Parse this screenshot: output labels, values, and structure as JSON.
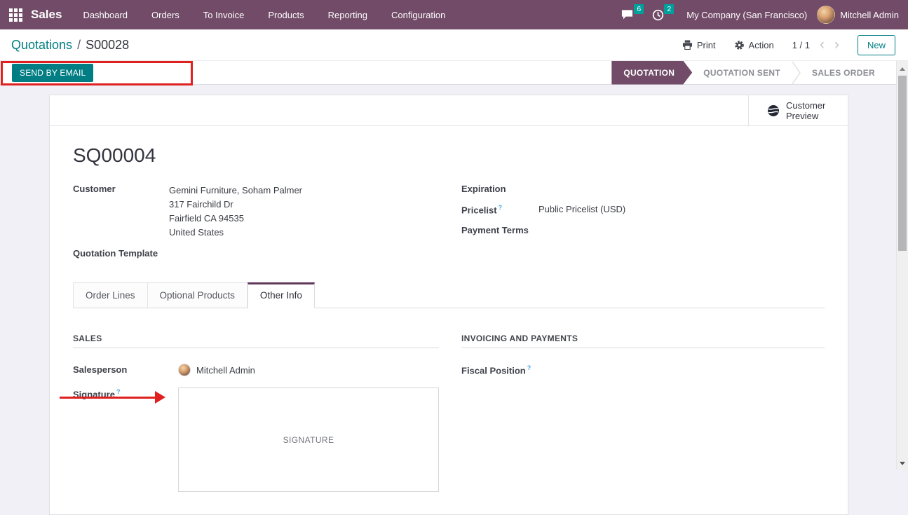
{
  "colors": {
    "brand_purple": "#714B67",
    "accent_teal": "#017E84",
    "badge_teal": "#00A09D",
    "annotation_red": "#E0201F",
    "help_blue": "#4AA3DF"
  },
  "navbar": {
    "app_name": "Sales",
    "menu_items": [
      "Dashboard",
      "Orders",
      "To Invoice",
      "Products",
      "Reporting",
      "Configuration"
    ],
    "messages_badge": "6",
    "activities_badge": "2",
    "company_name": "My Company (San Francisco)",
    "user_name": "Mitchell Admin"
  },
  "breadcrumb": {
    "parent": "Quotations",
    "separator": "/",
    "current": "S00028"
  },
  "toolbar": {
    "print_label": "Print",
    "action_label": "Action",
    "pager": "1 / 1",
    "prev_icon": "‹",
    "next_icon": "›",
    "new_label": "New"
  },
  "statusbar": {
    "send_by_email_label": "SEND BY EMAIL",
    "active_stage": "QUOTATION",
    "stages": [
      {
        "label": "QUOTATION"
      },
      {
        "label": "QUOTATION SENT"
      },
      {
        "label": "SALES ORDER"
      }
    ]
  },
  "sheet": {
    "customer_preview_label": "Customer Preview",
    "title": "SQ00004",
    "customer": {
      "label": "Customer",
      "lines": [
        "Gemini Furniture, Soham Palmer",
        "317 Fairchild Dr",
        "Fairfield CA 94535",
        "United States"
      ]
    },
    "quotation_template": {
      "label": "Quotation Template",
      "value": ""
    },
    "expiration": {
      "label": "Expiration",
      "value": ""
    },
    "pricelist": {
      "label": "Pricelist",
      "help": "?",
      "value": "Public Pricelist (USD)"
    },
    "payment_terms": {
      "label": "Payment Terms",
      "value": ""
    },
    "tabs": [
      "Order Lines",
      "Optional Products",
      "Other Info"
    ],
    "active_tab": "Other Info",
    "sales_section": {
      "title": "SALES",
      "salesperson": {
        "label": "Salesperson",
        "value": "Mitchell Admin"
      },
      "signature": {
        "label": "Signature",
        "help": "?",
        "placeholder": "SIGNATURE"
      }
    },
    "invoicing_section": {
      "title": "INVOICING AND PAYMENTS",
      "fiscal_position": {
        "label": "Fiscal Position",
        "help": "?",
        "value": ""
      }
    }
  }
}
